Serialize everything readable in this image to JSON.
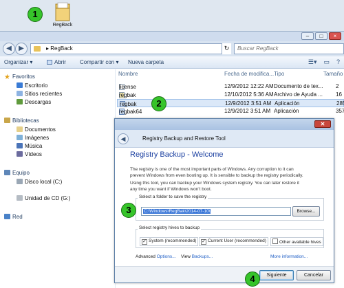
{
  "desktop": {
    "folder_label": "RegBack",
    "callouts": [
      "1",
      "2",
      "3",
      "4"
    ]
  },
  "explorer": {
    "address": "RegBack",
    "search_placeholder": "Buscar RegBack",
    "toolbar": {
      "organize": "Organizar ▾",
      "open": "Abrir",
      "share": "Compartir con ▾",
      "new_folder": "Nueva carpeta"
    },
    "sidebar": {
      "favorites": "Favoritos",
      "fav_items": [
        "Escritorio",
        "Sitios recientes",
        "Descargas"
      ],
      "libraries": "Bibliotecas",
      "lib_items": [
        "Documentos",
        "Imágenes",
        "Música",
        "Vídeos"
      ],
      "computer": "Equipo",
      "comp_items": [
        "Disco local (C:)",
        "Unidad de CD (G:)"
      ],
      "network": "Red"
    },
    "columns": [
      "Nombre",
      "Fecha de modifica...",
      "Tipo",
      "Tamaño"
    ],
    "files": [
      {
        "name": "license",
        "date": "12/9/2012 12:22 AM",
        "type": "Documento de tex...",
        "size": "2"
      },
      {
        "name": "regbak",
        "date": "12/10/2012 5:36 AM",
        "type": "Archivo de Ayuda ...",
        "size": "16"
      },
      {
        "name": "regbak",
        "date": "12/9/2012 3:51 AM",
        "type": "Aplicación",
        "size": "285"
      },
      {
        "name": "regbak64",
        "date": "12/9/2012 3:51 AM",
        "type": "Aplicación",
        "size": "357"
      }
    ]
  },
  "dialog": {
    "window_title": "Registry Backup and Restore Tool",
    "heading": "Registry Backup - Welcome",
    "para1_line1": "The registry is one of the most important parts of Windows. Any corruption to it can",
    "para1_line2": "prevent Windows from even booting up. It is sensible to backup the registry periodically.",
    "para2_line1": "Using this tool, you can backup your Windows system registry. You can later restore it",
    "para2_line2": "any time you want if Windows won't boot.",
    "folder_group_label": "Select a folder to save the registry",
    "folder_path": "C:\\Windows\\RegBak\\2014-07-10\\",
    "browse": "Browse...",
    "hives_group_label": "Select registry hives to backup",
    "hive_system": "System (recommended)",
    "hive_user": "Current User (recommended)",
    "hive_other": "Other available hives",
    "check_mark": "✓",
    "advanced_prefix": "Advanced",
    "options_link": "Options...",
    "view_prefix": "View",
    "backups_link": "Backups...",
    "more_info": "More information...",
    "next_button": "Siguiente",
    "cancel_button": "Cancelar"
  },
  "colors": {
    "callout": "#36c42a",
    "link": "#1a5bc4",
    "heading": "#1a3fa0",
    "selection": "#3875d7"
  }
}
